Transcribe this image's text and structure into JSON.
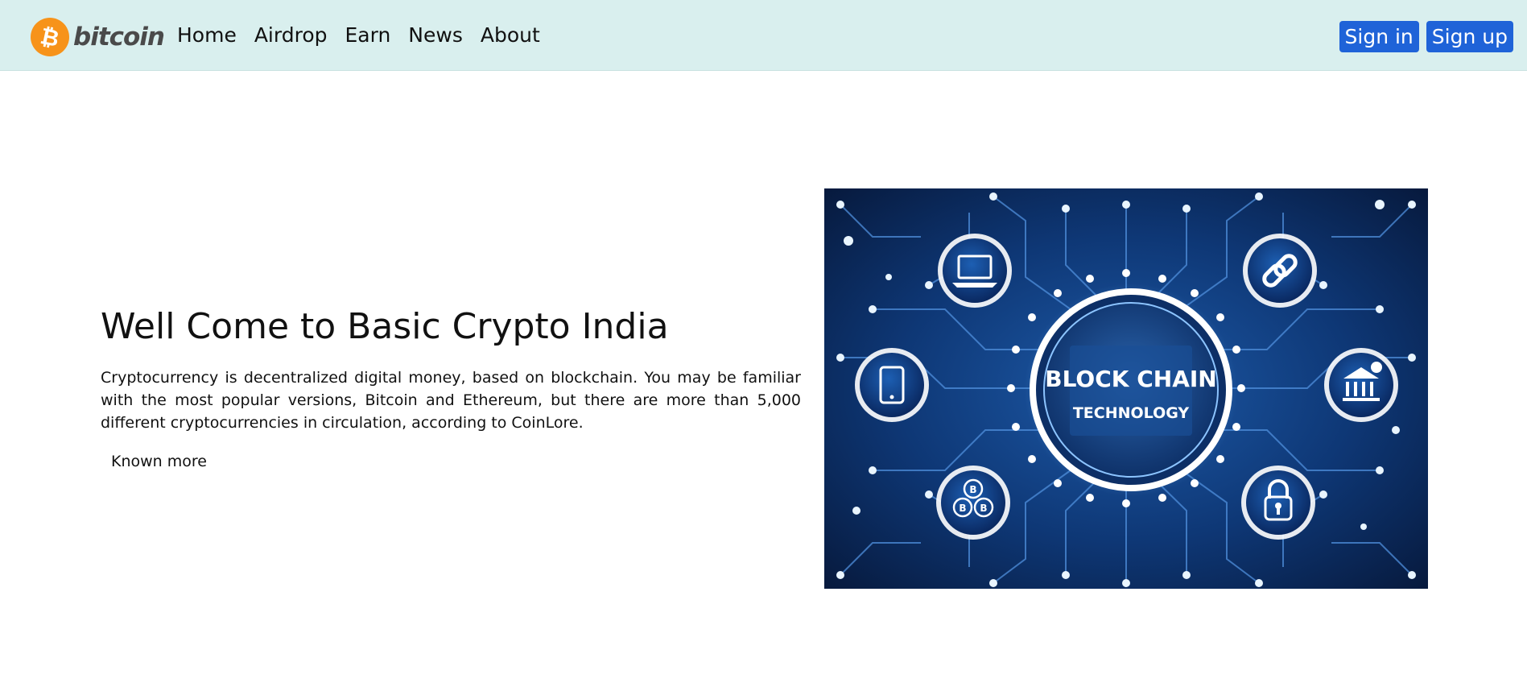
{
  "navbar": {
    "brand": "bitcoin",
    "brand_icon": "bitcoin-coin-icon",
    "links": [
      "Home",
      "Airdrop",
      "Earn",
      "News",
      "About"
    ],
    "sign_in": "Sign in",
    "sign_up": "Sign up"
  },
  "hero": {
    "title": "Well Come to Basic Crypto India",
    "text": "Cryptocurrency is decentralized digital money, based on blockchain. You may be familiar with the most popular versions, Bitcoin and Ethereum, but there are more than 5,000 different cryptocurrencies in circulation, according to CoinLore.",
    "link": "Known more",
    "image": {
      "title": "BLOCK CHAIN",
      "subtitle": "TECHNOLOGY",
      "icons": [
        "laptop-icon",
        "link-chain-icon",
        "tablet-icon",
        "bank-icon",
        "bitcoin-network-icon",
        "padlock-icon"
      ]
    }
  },
  "colors": {
    "navbar_bg": "#d9efee",
    "button_bg": "#1f63d8",
    "brand_orange": "#f7931a",
    "image_bg": "#0b2a5c"
  }
}
